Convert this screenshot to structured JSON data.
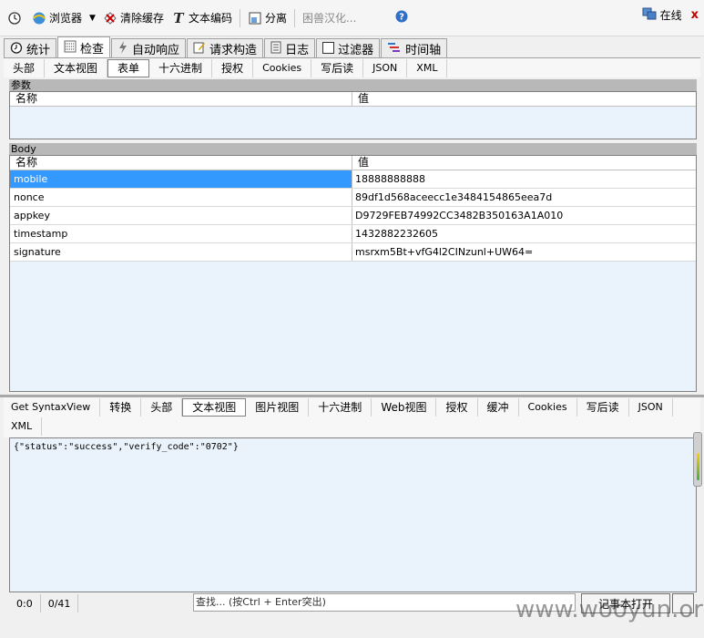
{
  "toolbar": {
    "items": [
      {
        "icon": "clock-icon",
        "label": ""
      },
      {
        "icon": "browser-icon",
        "label": "浏览器"
      },
      {
        "icon": "clear-cache-icon",
        "label": "清除缓存"
      },
      {
        "icon": "text-encode-icon",
        "label": "文本编码"
      },
      {
        "icon": "detach-icon",
        "label": "分离"
      }
    ],
    "search_placeholder": "困兽汉化...",
    "online_label": "在线",
    "close_glyph": "x"
  },
  "main_tabs": [
    {
      "label": "统计",
      "icon": "stopwatch-icon"
    },
    {
      "label": "检查",
      "icon": "inspect-icon",
      "active": true
    },
    {
      "label": "自动响应",
      "icon": "lightning-icon"
    },
    {
      "label": "请求构造",
      "icon": "compose-icon"
    },
    {
      "label": "日志",
      "icon": "log-icon"
    },
    {
      "label": "过滤器",
      "icon": "checkbox-icon"
    },
    {
      "label": "时间轴",
      "icon": "timeline-icon"
    }
  ],
  "request_tabs": [
    "头部",
    "文本视图",
    "表单",
    "十六进制",
    "授权",
    "Cookies",
    "写后读",
    "JSON",
    "XML"
  ],
  "request_active_tab": "表单",
  "params_panel": {
    "title": "参数",
    "col_name": "名称",
    "col_value": "值"
  },
  "body_panel": {
    "title": "Body",
    "col_name": "名称",
    "col_value": "值",
    "rows": [
      {
        "name": "mobile",
        "value": "18888888888"
      },
      {
        "name": "nonce",
        "value": "89df1d568aceecc1e3484154865eea7d"
      },
      {
        "name": "appkey",
        "value": "D9729FEB74992CC3482B350163A1A010"
      },
      {
        "name": "timestamp",
        "value": "1432882232605"
      },
      {
        "name": "signature",
        "value": "msrxm5Bt+vfG4l2CINzunl+UW64="
      }
    ]
  },
  "response_tabs_row1": [
    "Get SyntaxView",
    "转换",
    "头部",
    "文本视图",
    "图片视图",
    "十六进制",
    "Web视图",
    "授权",
    "缓冲",
    "Cookies",
    "写后读",
    "JSON"
  ],
  "response_tabs_row2": [
    "XML"
  ],
  "response_active_tab": "文本视图",
  "response_body": "{\"status\":\"success\",\"verify_code\":\"0702\"}",
  "statusbar": {
    "position": "0:0",
    "count": "0/41",
    "find_placeholder": "查找... (按Ctrl + Enter突出)",
    "notepad_button": "记事本打开"
  },
  "watermark": "www.wooyun.org"
}
